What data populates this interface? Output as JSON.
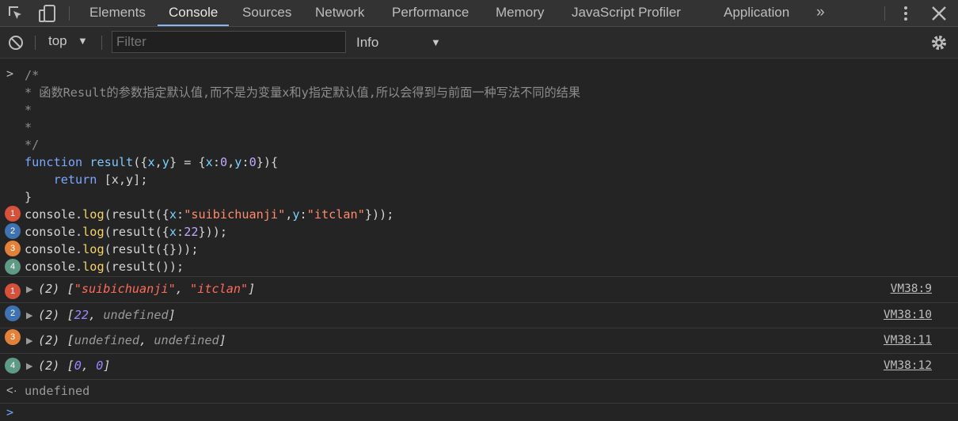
{
  "tabs": [
    "Elements",
    "Console",
    "Sources",
    "Network",
    "Performance",
    "Memory",
    "JavaScript Profiler",
    "Application"
  ],
  "active_tab": "Console",
  "toolbar": {
    "context": "top",
    "filter_placeholder": "Filter",
    "level": "Info"
  },
  "code": {
    "comment_open": "/*",
    "comment_line1": "* 函数Result的参数指定默认值,而不是为变量x和y指定默认值,所以会得到与前面一种写法不同的结果",
    "comment_star": "*",
    "comment_close": "*/"
  },
  "outputs": [
    {
      "badge": "1",
      "count": "(2)",
      "source": "VM38:9"
    },
    {
      "badge": "2",
      "count": "(2)",
      "source": "VM38:10"
    },
    {
      "badge": "3",
      "count": "(2)",
      "source": "VM38:11"
    },
    {
      "badge": "4",
      "count": "(2)",
      "source": "VM38:12"
    }
  ],
  "return_value": "undefined",
  "colors": {
    "background": "#242424",
    "tabbar": "#333333",
    "active_tab_underline": "#8ab4f8",
    "badge_1": "#d5513b",
    "badge_2": "#3f72b0",
    "badge_3": "#e2823a",
    "badge_4": "#5f9a85"
  },
  "icons": [
    "inspect-element-icon",
    "device-toolbar-icon",
    "more-tabs-icon",
    "kebab-menu-icon",
    "close-icon",
    "clear-console-icon",
    "dropdown-arrow-icon",
    "settings-gear-icon",
    "expand-triangle-icon",
    "prompt-chevron-icon",
    "return-arrow-icon"
  ]
}
